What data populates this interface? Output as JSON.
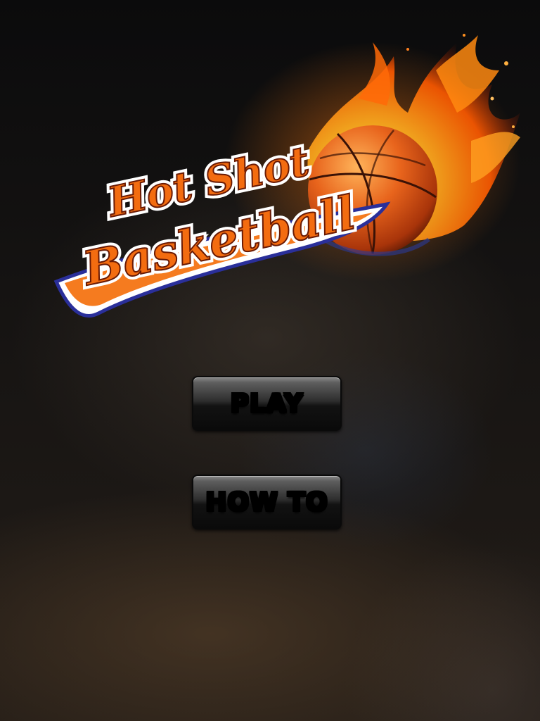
{
  "logo": {
    "line1": "Hot Shot",
    "line2": "Basketball"
  },
  "menu": {
    "play_label": "PLAY",
    "howto_label": "HOW TO"
  },
  "colors": {
    "text_orange": "#f36c10",
    "swoosh_orange": "#f57b1f",
    "ball_orange": "#e8641c",
    "button_text_yellow": "#ffe600",
    "outline_blue": "#2a2f9a"
  }
}
